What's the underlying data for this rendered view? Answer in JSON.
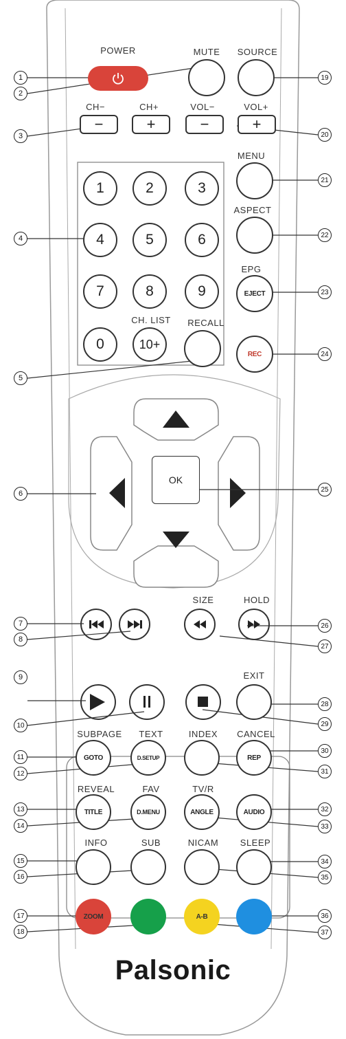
{
  "brand": "Palsonic",
  "labels": {
    "power": "POWER",
    "mute": "MUTE",
    "source": "SOURCE",
    "ch_minus": "CH−",
    "ch_plus": "CH+",
    "vol_minus": "VOL−",
    "vol_plus": "VOL+",
    "menu": "MENU",
    "aspect": "ASPECT",
    "epg": "EPG",
    "ch_list": "CH. LIST",
    "recall": "RECALL",
    "size": "SIZE",
    "hold": "HOLD",
    "exit": "EXIT",
    "subpage": "SUBPAGE",
    "text": "TEXT",
    "index": "INDEX",
    "cancel": "CANCEL",
    "reveal": "REVEAL",
    "fav": "FAV",
    "tv_r": "TV/R",
    "info": "INFO",
    "sub": "SUB",
    "nicam": "NICAM",
    "sleep": "SLEEP"
  },
  "buttons": {
    "num1": "1",
    "num2": "2",
    "num3": "3",
    "num4": "4",
    "num5": "5",
    "num6": "6",
    "num7": "7",
    "num8": "8",
    "num9": "9",
    "num0": "0",
    "num10": "10+",
    "eject": "EJECT",
    "rec": "REC",
    "ok": "OK",
    "goto": "GOTO",
    "dsetup": "D.SETUP",
    "rep": "REP",
    "title": "TITLE",
    "dmenu": "D.MENU",
    "angle": "ANGLE",
    "audio": "AUDIO",
    "zoom": "ZOOM",
    "ab": "A-B"
  },
  "callouts": {
    "c1": "1",
    "c2": "2",
    "c3": "3",
    "c4": "4",
    "c5": "5",
    "c6": "6",
    "c7": "7",
    "c8": "8",
    "c9": "9",
    "c10": "10",
    "c11": "11",
    "c12": "12",
    "c13": "13",
    "c14": "14",
    "c15": "15",
    "c16": "16",
    "c17": "17",
    "c18": "18",
    "c19": "19",
    "c20": "20",
    "c21": "21",
    "c22": "22",
    "c23": "23",
    "c24": "24",
    "c25": "25",
    "c26": "26",
    "c27": "27",
    "c28": "28",
    "c29": "29",
    "c30": "30",
    "c31": "31",
    "c32": "32",
    "c33": "33",
    "c34": "34",
    "c35": "35",
    "c36": "36",
    "c37": "37"
  },
  "colors": {
    "power": "#d9443a",
    "zoom": "#d9443a",
    "green": "#16a04a",
    "yellow": "#f4d320",
    "blue": "#1f8fe0",
    "rec_text": "#c0392b"
  }
}
